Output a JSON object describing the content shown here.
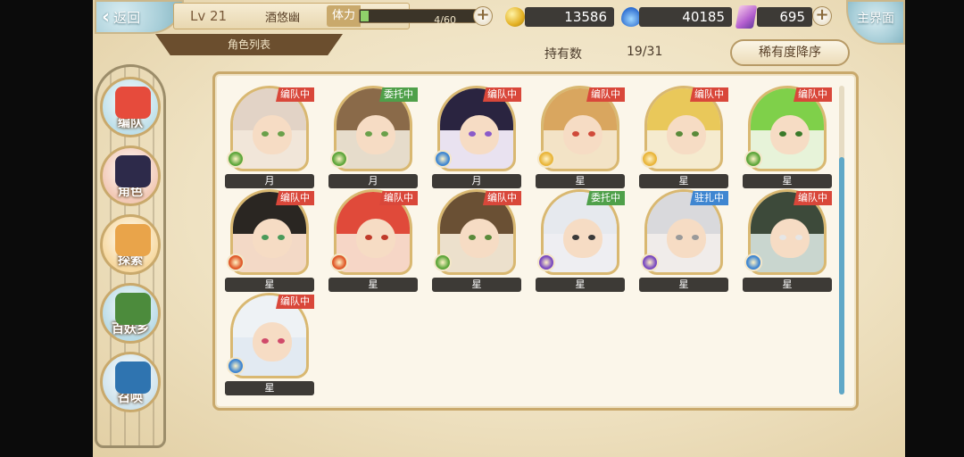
{
  "header": {
    "back_label": "返回",
    "level": "Lv 21",
    "player_name": "酒悠幽",
    "stamina_label": "体力",
    "stamina_value": "4/60",
    "stamina_fraction": 0.067,
    "gold": "13586",
    "soul": "40185",
    "crystal": "695",
    "home_label": "主界面",
    "tab_label": "角色列表"
  },
  "owned": {
    "label": "持有数",
    "value": "19/31"
  },
  "sort_label": "稀有度降序",
  "nav": [
    {
      "label": "编队",
      "bg": "#bfe0ea",
      "art": "#e64b3c"
    },
    {
      "label": "角色",
      "bg": "#f2c9b6",
      "art": "#2d2a4a"
    },
    {
      "label": "探索",
      "bg": "#f7d9a1",
      "art": "#e9a44a"
    },
    {
      "label": "百妖乡",
      "bg": "#b9dbe6",
      "art": "#4c8b3c"
    },
    {
      "label": "召唤",
      "bg": "#cfe3ec",
      "art": "#2f74b0"
    }
  ],
  "characters": [
    {
      "tag": "编队中",
      "tag_color": "#d9473a",
      "rank": "月",
      "hair": "#e2d3c6",
      "eye": "#6aa04a",
      "elem": "#5da63a",
      "bg": "#f1e6d9"
    },
    {
      "tag": "委托中",
      "tag_color": "#4fa04a",
      "rank": "月",
      "hair": "#8a6a49",
      "eye": "#6aa04a",
      "elem": "#5da63a",
      "bg": "#e6dccb"
    },
    {
      "tag": "编队中",
      "tag_color": "#d9473a",
      "rank": "月",
      "hair": "#2a2440",
      "eye": "#8a5ac9",
      "elem": "#3f86d1",
      "bg": "#e9e2f0"
    },
    {
      "tag": "编队中",
      "tag_color": "#d9473a",
      "rank": "星",
      "hair": "#d9a65f",
      "eye": "#d04a3a",
      "elem": "#e9b53a",
      "bg": "#f3e3c6"
    },
    {
      "tag": "编队中",
      "tag_color": "#d9473a",
      "rank": "星",
      "hair": "#e9c85a",
      "eye": "#5a8a3a",
      "elem": "#e9b53a",
      "bg": "#f5ebcf"
    },
    {
      "tag": "编队中",
      "tag_color": "#d9473a",
      "rank": "星",
      "hair": "#7fd04a",
      "eye": "#3a7a2a",
      "elem": "#5da63a",
      "bg": "#e7f3d9"
    },
    {
      "tag": "编队中",
      "tag_color": "#d9473a",
      "rank": "星",
      "hair": "#2a2622",
      "eye": "#4a9a5a",
      "elem": "#e05a2a",
      "bg": "#f3d9c6"
    },
    {
      "tag": "编队中",
      "tag_color": "#d9473a",
      "rank": "星",
      "hair": "#e04a3a",
      "eye": "#c03a2a",
      "elem": "#e05a2a",
      "bg": "#f6d6c6"
    },
    {
      "tag": "编队中",
      "tag_color": "#d9473a",
      "rank": "星",
      "hair": "#6a5034",
      "eye": "#5a8a3a",
      "elem": "#5da63a",
      "bg": "#ece0cc"
    },
    {
      "tag": "委托中",
      "tag_color": "#4fa04a",
      "rank": "星",
      "hair": "#e6e9ee",
      "eye": "#3a3a3a",
      "elem": "#7a4ac0",
      "bg": "#eeeef2"
    },
    {
      "tag": "驻扎中",
      "tag_color": "#3f86d1",
      "rank": "星",
      "hair": "#d9d9dc",
      "eye": "#9a9a9a",
      "elem": "#7a4ac0",
      "bg": "#f0ecea"
    },
    {
      "tag": "编队中",
      "tag_color": "#d9473a",
      "rank": "星",
      "hair": "#3d4a3a",
      "eye": "#e6e6e6",
      "elem": "#3f86d1",
      "bg": "#c9d6cf"
    },
    {
      "tag": "编队中",
      "tag_color": "#d9473a",
      "rank": "星",
      "hair": "#eef2f5",
      "eye": "#d04a6a",
      "elem": "#3f86d1",
      "bg": "#e2eaf2"
    }
  ]
}
